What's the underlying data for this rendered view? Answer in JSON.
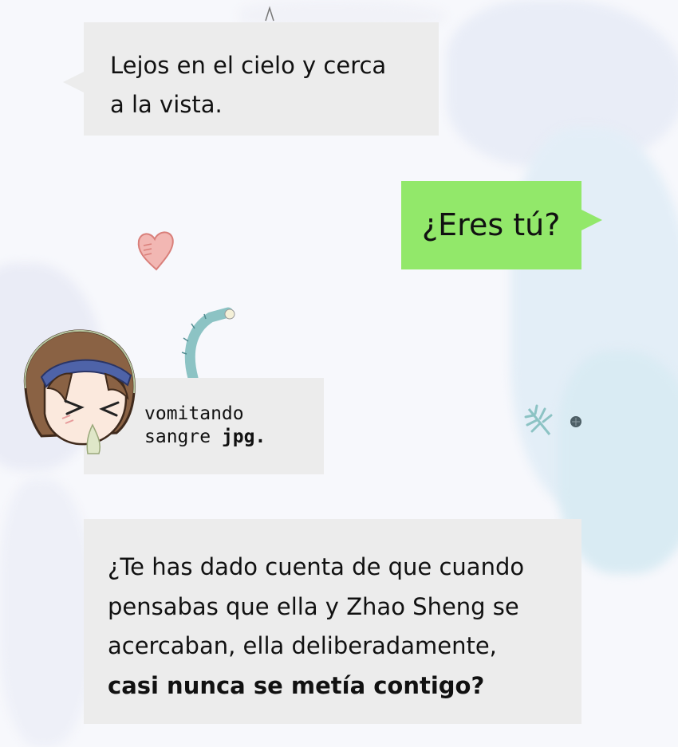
{
  "messages": {
    "m1": {
      "line1": "Lejos en el cielo y cerca",
      "line2": "a la vista."
    },
    "m2": {
      "text": "¿Eres tú?"
    },
    "m3": {
      "line1": "vomitando",
      "line2_prefix": "sangre ",
      "line2_bold": "jpg."
    },
    "m4": {
      "line1": "¿Te has dado cuenta de que cuando",
      "line2": "pensabas que ella y Zhao Sheng se",
      "line3": "acercaban, ella deliberadamente,",
      "line4": "casi nunca se metía contigo?"
    }
  },
  "colors": {
    "incoming_bubble": "#ececec",
    "outgoing_bubble": "#92e86a",
    "text": "#111111"
  },
  "icons": [
    "heart-icon",
    "cactus-icon",
    "leaf-icon",
    "dot-icon",
    "avatar-girl-icon"
  ]
}
